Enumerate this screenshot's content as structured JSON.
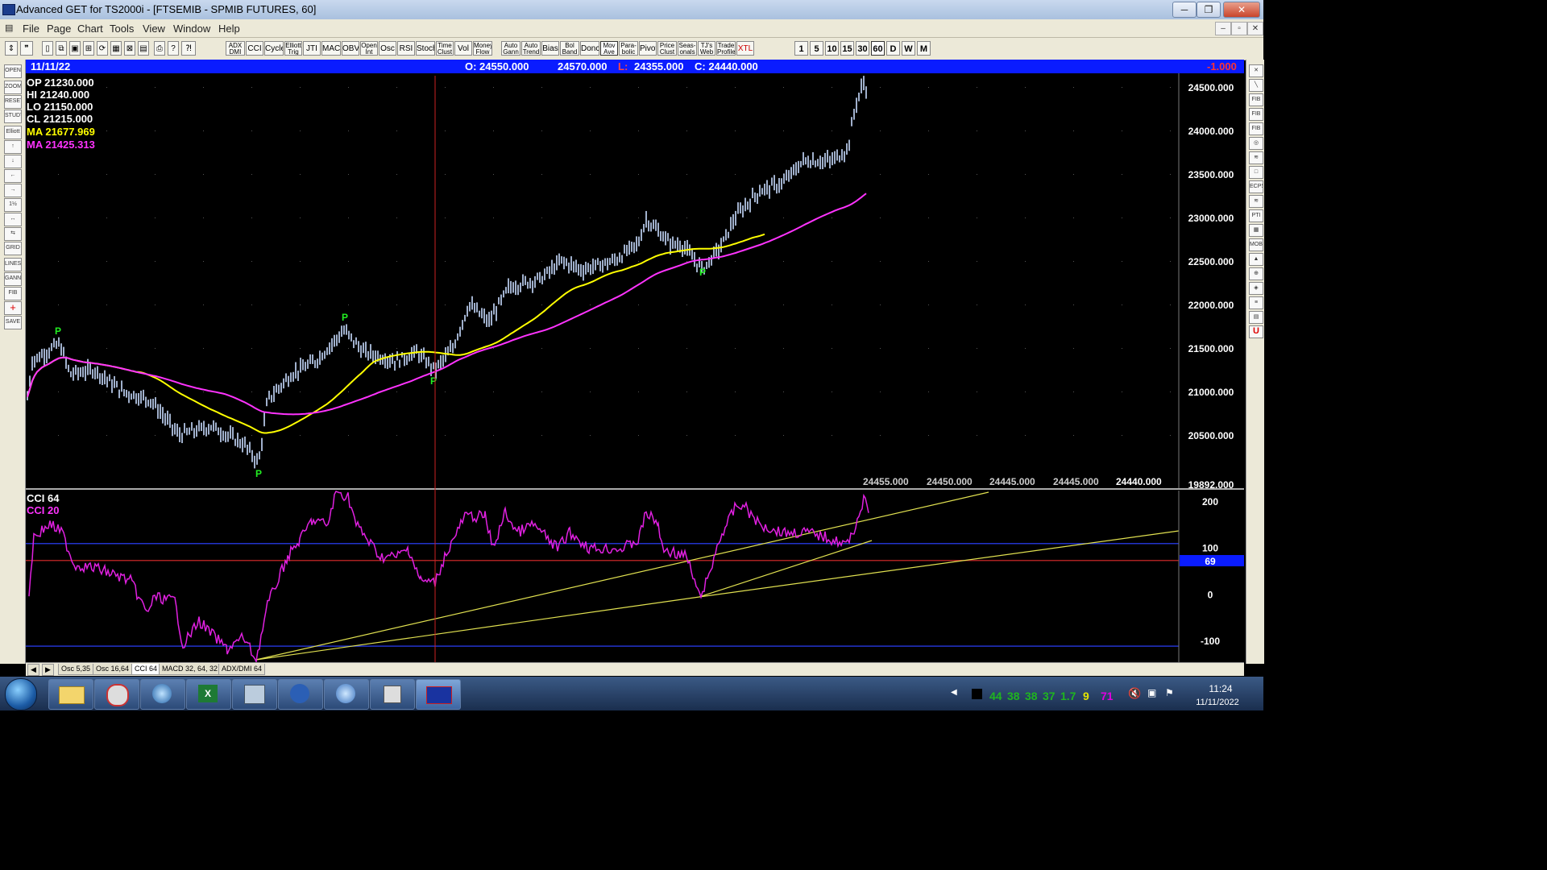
{
  "window": {
    "title": "Advanced GET for TS2000i - [FTSEMIB - SPMIB FUTURES, 60]",
    "min": "─",
    "max": "❐",
    "close": "✕"
  },
  "menu": {
    "items": [
      "File",
      "Page",
      "Chart",
      "Tools",
      "View",
      "Window",
      "Help"
    ],
    "mdi": [
      "–",
      "▫",
      "✕"
    ]
  },
  "toolbar": {
    "studies": [
      {
        "label": "ADX DMI"
      },
      {
        "label": "CCI"
      },
      {
        "label": "Cycles"
      },
      {
        "label": "Elliott Trig"
      },
      {
        "label": "JTI"
      },
      {
        "label": "MACD"
      },
      {
        "label": "OBV"
      },
      {
        "label": "Open Int"
      },
      {
        "label": "Osc"
      },
      {
        "label": "RSI"
      },
      {
        "label": "Stoch"
      },
      {
        "label": "Time Clust"
      },
      {
        "label": "Vol"
      },
      {
        "label": "Money Flow"
      },
      {
        "label": "Auto Gann"
      },
      {
        "label": "Auto Trend"
      },
      {
        "label": "Bias"
      },
      {
        "label": "Bol Band"
      },
      {
        "label": "Donch"
      },
      {
        "label": "Mov Ave"
      },
      {
        "label": "Para- bolic"
      },
      {
        "label": "Pivot"
      },
      {
        "label": "Price Clust"
      },
      {
        "label": "Seas- onals"
      },
      {
        "label": "TJ's Web"
      },
      {
        "label": "Trade Profile"
      },
      {
        "label": "XTL"
      }
    ],
    "intervals": [
      "1",
      "5",
      "10",
      "15",
      "30",
      "60",
      "D",
      "W",
      "M"
    ],
    "active_interval": "60"
  },
  "left_tools": [
    "OPEN",
    "ZOOM",
    "RESET",
    "STUDY",
    "Elliott",
    "↑",
    "↓",
    "←",
    "→",
    "1½",
    "↔",
    "⇆",
    "GRID",
    "LINES",
    "GANN",
    "FIB",
    "+",
    "SAVE"
  ],
  "right_tools": [
    "✕",
    "╲",
    "FIB RET",
    "FIB EXT",
    "FIB TIME",
    "◎",
    "≋",
    "□",
    "ECPS",
    "≋",
    "PTI",
    "▦",
    "MOB",
    "▲",
    "⊕",
    "◈",
    "≡",
    "▤",
    "U"
  ],
  "infobar": {
    "date": "11/11/22",
    "open": "O: 24550.000",
    "high": "24570.000",
    "low_label": "L:",
    "low": "24355.000",
    "close": "C: 24440.000",
    "change": "-1.000"
  },
  "price_legend": {
    "op": "OP  21230.000",
    "hi": "HI   21240.000",
    "lo": "LO  21150.000",
    "cl": "CL  21215.000",
    "ma1": "MA  21677.969",
    "ma2": "MA  21425.313"
  },
  "price_axis": [
    "24500.000",
    "24000.000",
    "23500.000",
    "23000.000",
    "22500.000",
    "22000.000",
    "21500.000",
    "21000.000",
    "20500.000",
    "19892.000"
  ],
  "projection_values": [
    "24455.000",
    "24450.000",
    "24445.000",
    "24445.000",
    "24440.000"
  ],
  "pivot_marker": "P",
  "indicator_legend": {
    "cci64": "CCI 64",
    "cci20": "CCI  20"
  },
  "cci_axis": [
    "200",
    "100",
    "0",
    "-100"
  ],
  "cci_current": "69",
  "tabs": {
    "nav": [
      "◀",
      "▶"
    ],
    "items": [
      "Osc 5,35",
      "Osc 16,64",
      "CCI 64",
      "MACD 32, 64, 32",
      "ADX/DMI 64"
    ],
    "active": "CCI 64"
  },
  "tray": {
    "numbers": [
      {
        "v": "44",
        "c": "#1fb51f"
      },
      {
        "v": "38",
        "c": "#1fb51f"
      },
      {
        "v": "38",
        "c": "#1fb51f"
      },
      {
        "v": "37",
        "c": "#1fb51f"
      },
      {
        "v": "1.7",
        "c": "#1fb51f"
      },
      {
        "v": "9",
        "c": "#e5e500"
      },
      {
        "v": "71",
        "c": "#e000e0"
      }
    ],
    "time": "11:24",
    "date": "11/11/2022"
  },
  "colors": {
    "price_bars": "#c8dcff",
    "ma_fast": "#ffff00",
    "ma_slow": "#ff33ff",
    "cci": "#e020e0",
    "trendline": "#e0e050",
    "pivot": "#22ee22",
    "cursor": "#cc2222",
    "infobar": "#0a1cff"
  }
}
